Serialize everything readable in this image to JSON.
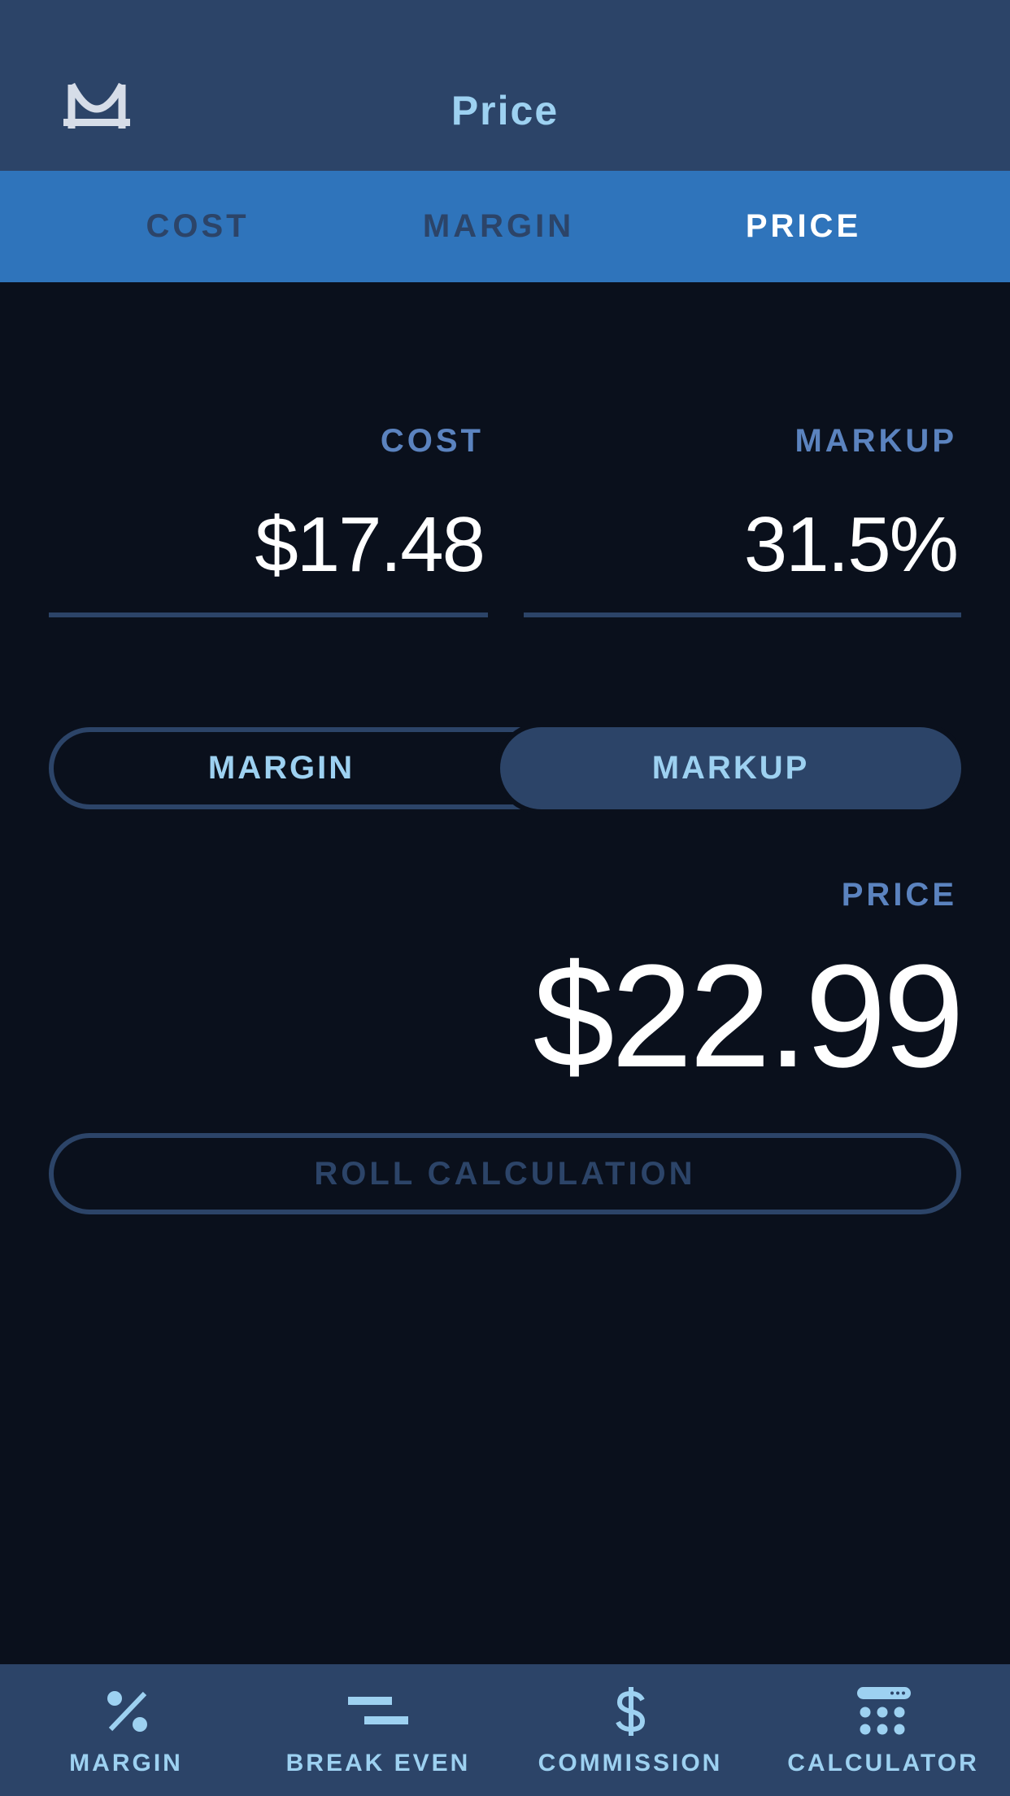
{
  "header": {
    "logo_icon": "M-logo-icon",
    "title": "Price"
  },
  "tabs": [
    {
      "label": "COST",
      "active": false
    },
    {
      "label": "MARGIN",
      "active": false
    },
    {
      "label": "PRICE",
      "active": true
    }
  ],
  "fields": {
    "cost": {
      "label": "COST",
      "value": "$17.48"
    },
    "markup": {
      "label": "MARKUP",
      "value": "31.5%"
    }
  },
  "mode_toggle": {
    "options": [
      {
        "label": "MARGIN",
        "selected": false
      },
      {
        "label": "MARKUP",
        "selected": true
      }
    ]
  },
  "result": {
    "label": "PRICE",
    "value": "$22.99"
  },
  "roll_button": {
    "label": "ROLL CALCULATION"
  },
  "bottom_nav": [
    {
      "label": "MARGIN",
      "icon": "percent-icon"
    },
    {
      "label": "BREAK EVEN",
      "icon": "equals-icon"
    },
    {
      "label": "COMMISSION",
      "icon": "dollar-icon"
    },
    {
      "label": "CALCULATOR",
      "icon": "calculator-icon"
    }
  ],
  "colors": {
    "header_bg": "#2c4468",
    "tab_bar_bg": "#2f74bb",
    "page_bg": "#0a101c",
    "accent_light": "#9dd1f1",
    "label_blue": "#5b83bf"
  }
}
